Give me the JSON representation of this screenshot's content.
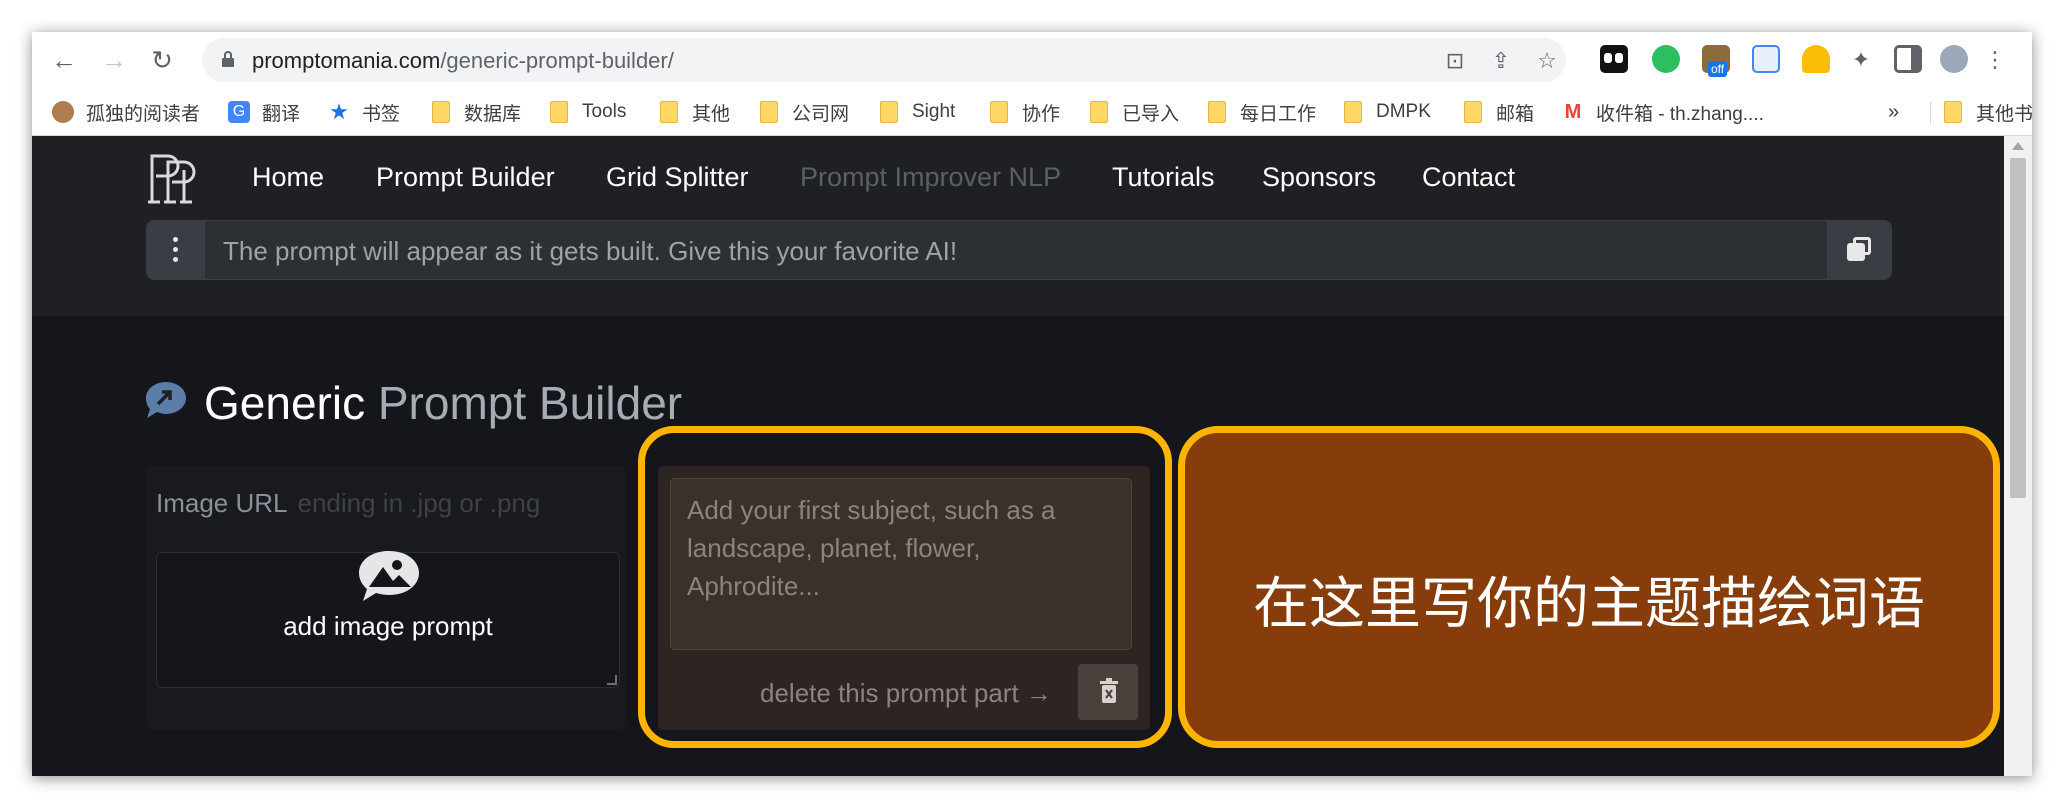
{
  "browser": {
    "url_domain": "promptomania.com",
    "url_path": "/generic-prompt-builder/",
    "extension_badge": "off"
  },
  "bookmarks": [
    {
      "label": "孤独的阅读者",
      "icon": "reader-avatar-icon"
    },
    {
      "label": "翻译",
      "icon": "translate-icon"
    },
    {
      "label": "书签",
      "icon": "star-icon"
    },
    {
      "label": "数据库",
      "icon": "folder-icon"
    },
    {
      "label": "Tools",
      "icon": "folder-icon"
    },
    {
      "label": "其他",
      "icon": "folder-icon"
    },
    {
      "label": "公司网",
      "icon": "folder-icon"
    },
    {
      "label": "Sight",
      "icon": "folder-icon"
    },
    {
      "label": "协作",
      "icon": "folder-icon"
    },
    {
      "label": "已导入",
      "icon": "folder-icon"
    },
    {
      "label": "每日工作",
      "icon": "folder-icon"
    },
    {
      "label": "DMPK",
      "icon": "folder-icon"
    },
    {
      "label": "邮箱",
      "icon": "folder-icon"
    },
    {
      "label": "收件箱 - th.zhang....",
      "icon": "gmail-icon"
    }
  ],
  "bookmarks_overflow": "»",
  "other_bookmarks": "其他书签",
  "nav": {
    "home": "Home",
    "prompt_builder": "Prompt Builder",
    "grid_splitter": "Grid Splitter",
    "prompt_improver": "Prompt Improver NLP",
    "tutorials": "Tutorials",
    "sponsors": "Sponsors",
    "contact": "Contact"
  },
  "prompt_bar": {
    "placeholder": "The prompt will appear as it gets built. Give this your favorite AI!"
  },
  "heading": {
    "bold": "Generic",
    "light": "Prompt Builder"
  },
  "image_card": {
    "label": "Image URL",
    "hint": "ending in .jpg or .png",
    "button": "add image prompt"
  },
  "prompt_part": {
    "placeholder": "Add your first subject, such as a landscape, planet, flower, Aphrodite...",
    "delete_label": "delete this prompt part →"
  },
  "annotation": {
    "text": "在这里写你的主题描绘词语",
    "border_color": "#ffb400",
    "fill_color": "#873c0c"
  }
}
